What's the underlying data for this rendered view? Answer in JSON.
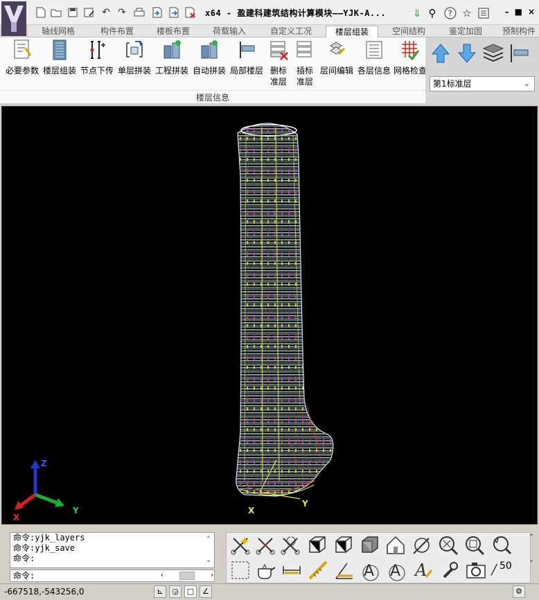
{
  "window": {
    "title": "x64 - 盈建科建筑结构计算模块——YJK-A...",
    "controls": [
      "–",
      "■",
      "×"
    ]
  },
  "quick_access": [
    "new-file-icon",
    "open-icon",
    "save-icon",
    "save-as-icon",
    "undo-icon",
    "redo-icon",
    "print-icon",
    "import-icon",
    "export-icon",
    "close-file-icon"
  ],
  "tabs": [
    {
      "label": "轴线网格",
      "active": false
    },
    {
      "label": "构件布置",
      "active": false
    },
    {
      "label": "楼板布置",
      "active": false
    },
    {
      "label": "荷载输入",
      "active": false
    },
    {
      "label": "自定义工况",
      "active": false
    },
    {
      "label": "楼层组装",
      "active": true
    },
    {
      "label": "空间结构",
      "active": false
    },
    {
      "label": "鉴定加固",
      "active": false
    },
    {
      "label": "预制构件",
      "active": false
    }
  ],
  "ribbon": {
    "buttons": [
      {
        "label": "必要参数"
      },
      {
        "label": "楼层组装"
      },
      {
        "label": "节点下传"
      },
      {
        "label": "单层拼装"
      },
      {
        "label": "工程拼装"
      },
      {
        "label": "自动拼装"
      },
      {
        "label": "局部楼层"
      },
      {
        "label": "删标\n准层"
      },
      {
        "label": "插标\n准层"
      },
      {
        "label": "层间编辑"
      },
      {
        "label": "各层信息"
      },
      {
        "label": "网格检查"
      }
    ],
    "group_label": "楼层信息"
  },
  "floor_selector": {
    "value": "第1标准层"
  },
  "viewport": {
    "axis_labels": {
      "x": "X",
      "y": "Y",
      "z": "Z"
    },
    "model_axis_labels": {
      "x": "X",
      "y": "Y"
    }
  },
  "command": {
    "history": [
      "命令:yjk_layers",
      "命令:yjk_save",
      "命令:"
    ],
    "prompt": "命令:"
  },
  "status": {
    "coords": "-667518,-543256,0",
    "zoom_text": "50"
  }
}
